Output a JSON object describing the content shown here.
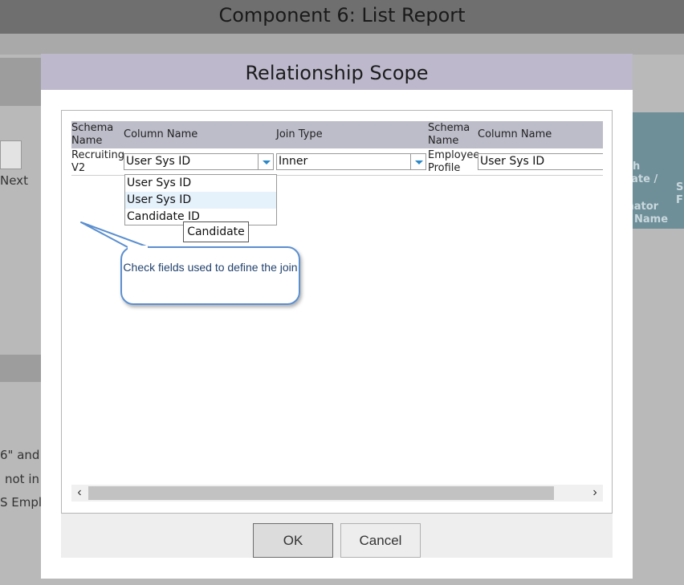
{
  "background": {
    "page_title": "Component 6: List Report",
    "fragments": [
      "Next",
      "6\" and",
      "not in",
      "S Empl"
    ],
    "teal_panel": [
      "h",
      "ciate /",
      "inator",
      "Name",
      "S",
      "F"
    ]
  },
  "dialog": {
    "title": "Relationship Scope",
    "headers": {
      "schema_name_1": "Schema Name",
      "column_name_1": "Column Name",
      "join_type": "Join Type",
      "schema_name_2": "Schema Name",
      "column_name_2": "Column Name"
    },
    "row": {
      "schema_1": "Recruiting V2",
      "column_1": "User Sys ID",
      "join_type": "Inner",
      "schema_2": "Employee Profile",
      "column_2": "User Sys ID"
    },
    "dropdown_options": [
      "User Sys ID",
      "User Sys ID",
      "Candidate ID"
    ],
    "tooltip": "Candidate",
    "callout": "Check fields used to define the join",
    "ok_label": "OK",
    "cancel_label": "Cancel"
  },
  "colors": {
    "header_band": "#bdb8cc",
    "table_header": "#bdbdca",
    "dropdown_arrow": "#2a88c8",
    "callout_border": "#5b8fcf"
  }
}
